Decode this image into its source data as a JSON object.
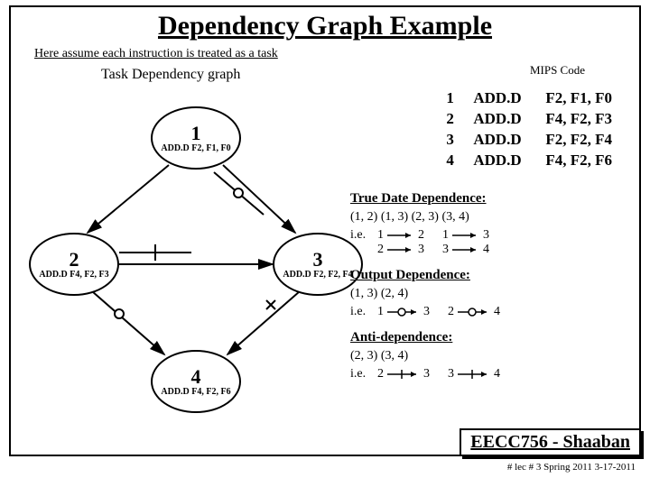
{
  "title": "Dependency Graph Example",
  "subtitle": "Here assume each instruction is treated as a task",
  "graph_label": "Task Dependency graph",
  "mips_label": "MIPS Code",
  "code": [
    {
      "n": "1",
      "op": "ADD.D",
      "args": "F2, F1, F0"
    },
    {
      "n": "2",
      "op": "ADD.D",
      "args": "F4, F2, F3"
    },
    {
      "n": "3",
      "op": "ADD.D",
      "args": "F2, F2, F4"
    },
    {
      "n": "4",
      "op": "ADD.D",
      "args": "F4, F2, F6"
    }
  ],
  "nodes": {
    "n1": {
      "num": "1",
      "instr": "ADD.D  F2, F1, F0"
    },
    "n2": {
      "num": "2",
      "instr": "ADD.D  F4, F2, F3"
    },
    "n3": {
      "num": "3",
      "instr": "ADD.D  F2, F2, F4"
    },
    "n4": {
      "num": "4",
      "instr": "ADD.D  F4, F2, F6"
    }
  },
  "true_dep": {
    "heading": "True Date Dependence:",
    "pairs": "(1, 2)    (1, 3)    (2, 3)     (3, 4)",
    "ie_prefix": "i.e.",
    "arrows_a": [
      [
        "1",
        "2"
      ],
      [
        "1",
        "3"
      ]
    ],
    "arrows_b": [
      [
        "2",
        "3"
      ],
      [
        "3",
        "4"
      ]
    ]
  },
  "output_dep": {
    "heading": "Output Dependence:",
    "pairs": "(1, 3)    (2, 4)",
    "ie_prefix": "i.e.",
    "arrows": [
      [
        "1",
        "3"
      ],
      [
        "2",
        "4"
      ]
    ]
  },
  "anti_dep": {
    "heading": "Anti-dependence:",
    "pairs": "(2, 3)    (3, 4)",
    "ie_prefix": "i.e.",
    "arrows": [
      [
        "2",
        "3"
      ],
      [
        "3",
        "4"
      ]
    ]
  },
  "footer": {
    "course": "EECC756 - Shaaban",
    "note": "#  lec # 3   Spring 2011  3-17-2011"
  }
}
